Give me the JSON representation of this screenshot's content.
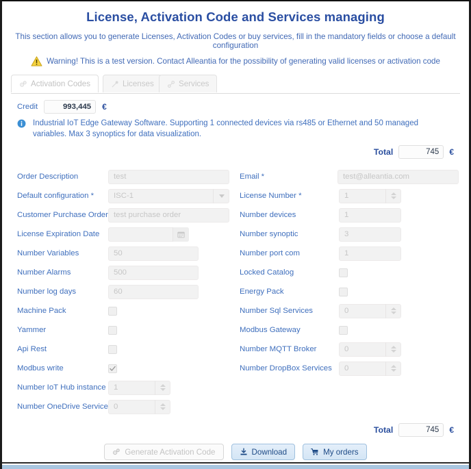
{
  "header": {
    "title": "License, Activation Code and Services managing",
    "subtitle": "This section allows you to generate Licenses, Activation Codes or buy services, fill in the mandatory fields or choose a default configuration",
    "warning_icon": "warning-triangle-icon",
    "warning": "Warning! This is a test version. Contact Alleantia for the possibility of generating valid licenses or activation code",
    "title_color": "#2a4ea2",
    "text_color": "#4169b5"
  },
  "tabs": [
    {
      "label": "Activation Codes",
      "icon": "gears-icon",
      "active": true
    },
    {
      "label": "Licenses",
      "icon": "key-icon",
      "active": false
    },
    {
      "label": "Services",
      "icon": "link-icon",
      "active": false
    }
  ],
  "credit": {
    "label": "Credit",
    "value": "993,445",
    "currency": "€"
  },
  "info": {
    "icon": "info-circle-icon",
    "text": "Industrial IoT Edge Gateway Software. Supporting 1 connected devices via rs485 or Ethernet and 50 managed variables. Max 3 synoptics for data visualization."
  },
  "total_top": {
    "label": "Total",
    "value": "745",
    "currency": "€"
  },
  "total_bottom": {
    "label": "Total",
    "value": "745",
    "currency": "€"
  },
  "form": {
    "left": [
      {
        "label": "Order Description",
        "type": "text",
        "value": "test",
        "size": "wide"
      },
      {
        "label": "Default configuration *",
        "type": "select",
        "value": "ISC-1"
      },
      {
        "label": "Customer Purchase Order *",
        "type": "text",
        "value": "test purchase order",
        "size": "wide"
      },
      {
        "label": "License Expiration Date",
        "type": "date",
        "value": ""
      },
      {
        "label": "Number Variables",
        "type": "text",
        "value": "50",
        "size": "med"
      },
      {
        "label": "Number Alarms",
        "type": "text",
        "value": "500",
        "size": "med"
      },
      {
        "label": "Number log days",
        "type": "text",
        "value": "60",
        "size": "med"
      },
      {
        "label": "Machine Pack",
        "type": "checkbox",
        "checked": false
      },
      {
        "label": "Yammer",
        "type": "checkbox",
        "checked": false
      },
      {
        "label": "Api Rest",
        "type": "checkbox",
        "checked": false
      },
      {
        "label": "Modbus write",
        "type": "checkbox",
        "checked": true
      },
      {
        "label": "Number IoT Hub instance",
        "type": "spinner",
        "value": "1",
        "size": "narrow"
      },
      {
        "label": "Number OneDrive Services",
        "type": "spinner",
        "value": "0",
        "size": "narrow"
      }
    ],
    "right": [
      {
        "label": "Email *",
        "type": "text",
        "value": "test@alleantia.com",
        "size": "wide"
      },
      {
        "label": "License Number *",
        "type": "spinner",
        "value": "1",
        "size": "narrow"
      },
      {
        "label": "Number devices",
        "type": "text",
        "value": "1",
        "size": "narrow"
      },
      {
        "label": "Number synoptic",
        "type": "text",
        "value": "3",
        "size": "narrow"
      },
      {
        "label": "Number port com",
        "type": "text",
        "value": "1",
        "size": "narrow"
      },
      {
        "label": "Locked Catalog",
        "type": "checkbox",
        "checked": false
      },
      {
        "label": "Energy Pack",
        "type": "checkbox",
        "checked": false
      },
      {
        "label": "Number Sql Services",
        "type": "spinner",
        "value": "0",
        "size": "narrow"
      },
      {
        "label": "Modbus Gateway",
        "type": "checkbox",
        "checked": false
      },
      {
        "label": "Number MQTT Broker",
        "type": "spinner",
        "value": "0",
        "size": "narrow"
      },
      {
        "label": "Number DropBox Services",
        "type": "spinner",
        "value": "0",
        "size": "narrow"
      }
    ]
  },
  "buttons": [
    {
      "label": "Generate Activation Code",
      "icon": "gears-icon",
      "style": "disabled"
    },
    {
      "label": "Download",
      "icon": "download-icon",
      "style": "primary"
    },
    {
      "label": "My orders",
      "icon": "cart-icon",
      "style": "primary"
    }
  ]
}
